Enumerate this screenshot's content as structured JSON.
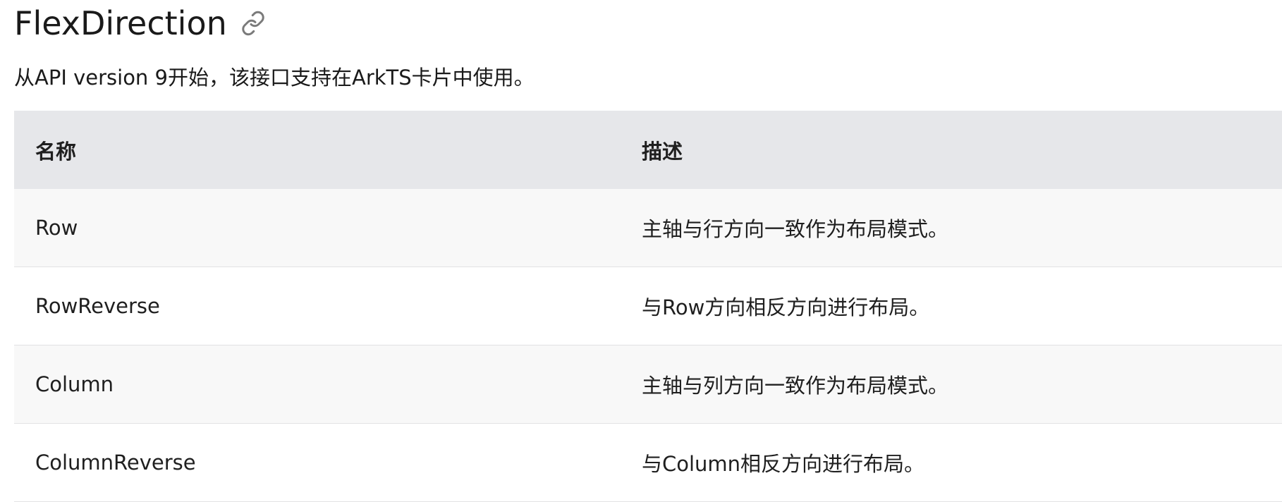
{
  "heading": {
    "title": "FlexDirection",
    "link_icon": "link-icon"
  },
  "note": "从API version 9开始，该接口支持在ArkTS卡片中使用。",
  "table": {
    "headers": {
      "name": "名称",
      "description": "描述"
    },
    "rows": [
      {
        "name": "Row",
        "description": "主轴与行方向一致作为布局模式。"
      },
      {
        "name": "RowReverse",
        "description": "与Row方向相反方向进行布局。"
      },
      {
        "name": "Column",
        "description": "主轴与列方向一致作为布局模式。"
      },
      {
        "name": "ColumnReverse",
        "description": "与Column相反方向进行布局。"
      }
    ]
  },
  "colors": {
    "header_bg": "#e6e7ea",
    "odd_row_bg": "#f8f8f8",
    "even_row_bg": "#ffffff",
    "text": "#1a1a1a",
    "icon": "#7a7a7a"
  }
}
